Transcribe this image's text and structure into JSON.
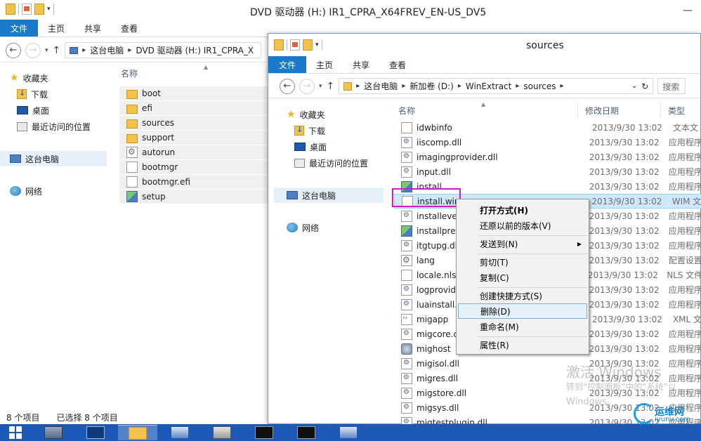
{
  "back_window": {
    "title": "DVD 驱动器 (H:) IR1_CPRA_X64FREV_EN-US_DV5",
    "tabs": [
      "文件",
      "主页",
      "共享",
      "查看"
    ],
    "breadcrumb": [
      "这台电脑",
      "DVD 驱动器 (H:) IR1_CPRA_X"
    ],
    "nav": {
      "favorites": "收藏夹",
      "downloads": "下载",
      "desktop": "桌面",
      "recent": "最近访问的位置",
      "this_pc": "这台电脑",
      "network": "网络"
    },
    "column_name": "名称",
    "files": [
      {
        "name": "boot",
        "icon": "folder-icon"
      },
      {
        "name": "efi",
        "icon": "folder-icon"
      },
      {
        "name": "sources",
        "icon": "folder-icon"
      },
      {
        "name": "support",
        "icon": "folder-icon"
      },
      {
        "name": "autorun",
        "icon": "settings-file-icon"
      },
      {
        "name": "bootmgr",
        "icon": "file-icon"
      },
      {
        "name": "bootmgr.efi",
        "icon": "file-icon"
      },
      {
        "name": "setup",
        "icon": "setup-icon"
      }
    ],
    "status": {
      "count": "8 个项目",
      "selected": "已选择 8 个项目"
    }
  },
  "front_window": {
    "title": "sources",
    "tabs": [
      "文件",
      "主页",
      "共享",
      "查看"
    ],
    "breadcrumb": [
      "这台电脑",
      "新加卷 (D:)",
      "WinExtract",
      "sources"
    ],
    "search_placeholder": "搜索",
    "nav": {
      "favorites": "收藏夹",
      "downloads": "下载",
      "desktop": "桌面",
      "recent": "最近访问的位置",
      "this_pc": "这台电脑",
      "network": "网络"
    },
    "columns": {
      "name": "名称",
      "date": "修改日期",
      "type": "类型"
    },
    "files": [
      {
        "name": "idwbinfo",
        "date": "2013/9/30 13:02",
        "type": "文本文",
        "icon": "file-icon"
      },
      {
        "name": "iiscomp.dll",
        "date": "2013/9/30 13:02",
        "type": "应用程序",
        "icon": "dll-icon"
      },
      {
        "name": "imagingprovider.dll",
        "date": "2013/9/30 13:02",
        "type": "应用程序",
        "icon": "dll-icon"
      },
      {
        "name": "input.dll",
        "date": "2013/9/30 13:02",
        "type": "应用程序",
        "icon": "dll-icon"
      },
      {
        "name": "install",
        "date": "2013/9/30 13:02",
        "type": "应用程序",
        "icon": "exe-icon"
      },
      {
        "name": "install.wim",
        "date": "2013/9/30 13:02",
        "type": "WIM 文",
        "icon": "file-icon"
      },
      {
        "name": "installevent",
        "date": "2013/9/30 13:02",
        "type": "应用程序",
        "icon": "dll-icon"
      },
      {
        "name": "installprep",
        "date": "2013/9/30 13:02",
        "type": "应用程序",
        "icon": "exe-icon"
      },
      {
        "name": "itgtupg.dll",
        "date": "2013/9/30 13:02",
        "type": "应用程序",
        "icon": "dll-icon"
      },
      {
        "name": "lang",
        "date": "2013/9/30 13:02",
        "type": "配置设置",
        "icon": "settings-file-icon"
      },
      {
        "name": "locale.nls",
        "date": "2013/9/30 13:02",
        "type": "NLS 文件",
        "icon": "file-icon"
      },
      {
        "name": "logprovide",
        "date": "2013/9/30 13:02",
        "type": "应用程序",
        "icon": "dll-icon"
      },
      {
        "name": "luainstall.d",
        "date": "2013/9/30 13:02",
        "type": "应用程序",
        "icon": "dll-icon"
      },
      {
        "name": "migapp",
        "date": "2013/9/30 13:02",
        "type": "XML 文",
        "icon": "xml-icon"
      },
      {
        "name": "migcore.dl",
        "date": "2013/9/30 13:02",
        "type": "应用程序",
        "icon": "dll-icon"
      },
      {
        "name": "mighost",
        "date": "2013/9/30 13:02",
        "type": "应用程序",
        "icon": "host-icon"
      },
      {
        "name": "migisol.dll",
        "date": "2013/9/30 13:02",
        "type": "应用程序",
        "icon": "dll-icon"
      },
      {
        "name": "migres.dll",
        "date": "2013/9/30 13:02",
        "type": "应用程序",
        "icon": "dll-icon"
      },
      {
        "name": "migstore.dll",
        "date": "2013/9/30 13:02",
        "type": "应用程序",
        "icon": "dll-icon"
      },
      {
        "name": "migsys.dll",
        "date": "2013/9/30 13:02",
        "type": "应用程序",
        "icon": "dll-icon"
      },
      {
        "name": "migtestplugin.dll",
        "date": "2013/9/30 13:02",
        "type": "应用程序",
        "icon": "dll-icon"
      }
    ]
  },
  "context_menu": {
    "items": [
      {
        "label": "打开方式(H)",
        "bold": true
      },
      {
        "label": "还原以前的版本(V)"
      },
      {
        "label": "发送到(N)",
        "submenu": true
      },
      {
        "label": "剪切(T)"
      },
      {
        "label": "复制(C)"
      },
      {
        "label": "创建快捷方式(S)"
      },
      {
        "label": "删除(D)",
        "highlighted": true
      },
      {
        "label": "重命名(M)"
      },
      {
        "label": "属性(R)"
      }
    ]
  },
  "watermark": {
    "activate_title": "激活 Windows",
    "activate_body": "转到“控制面板”中的“系统”以",
    "activate_body2": "Windows。",
    "site_logo_cn": "运维网",
    "site_logo_en": "iyunv.com"
  },
  "taskbar": {
    "items": [
      "server-manager-icon",
      "powershell-icon",
      "file-explorer-icon",
      "network-icon",
      "drive-icon",
      "cmd-icon",
      "cmd-icon",
      "network-icon"
    ]
  },
  "colors": {
    "file_tab": "#1979ca",
    "taskbar": "#1b58b8",
    "highlight_annotation": "#c81ec8",
    "selection": "#cde8ff"
  }
}
